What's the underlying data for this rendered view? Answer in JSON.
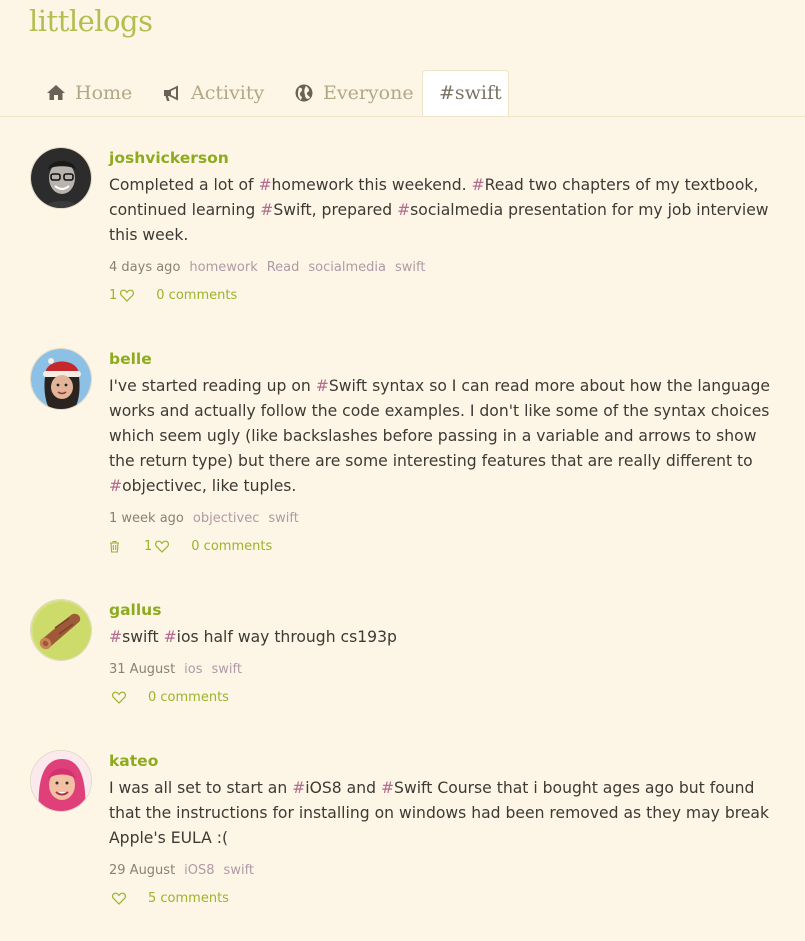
{
  "site": {
    "logo": "littlelogs"
  },
  "tabs": [
    {
      "label": "Home",
      "icon": "home-icon"
    },
    {
      "label": "Activity",
      "icon": "megaphone-icon"
    },
    {
      "label": "Everyone",
      "icon": "globe-icon"
    },
    {
      "label": "#swift",
      "active": true
    }
  ],
  "posts": [
    {
      "username": "joshvickerson",
      "avatar": "avatar-photo-glasses",
      "segments": [
        {
          "t": "Completed a lot of "
        },
        {
          "h": "#"
        },
        {
          "t": "homework this weekend. "
        },
        {
          "h": "#"
        },
        {
          "t": "Read two chapters of my textbook, continued learning "
        },
        {
          "h": "#"
        },
        {
          "t": "Swift, prepared "
        },
        {
          "h": "#"
        },
        {
          "t": "socialmedia presentation for my job interview this week."
        }
      ],
      "time": "4 days ago",
      "tags": [
        "homework",
        "Read",
        "socialmedia",
        "swift"
      ],
      "likes": "1",
      "comments": "0 comments",
      "trash": false
    },
    {
      "username": "belle",
      "avatar": "avatar-santa-hat",
      "segments": [
        {
          "t": "I've started reading up on "
        },
        {
          "h": "#"
        },
        {
          "t": "Swift syntax so I can read more about how the language works and actually follow the code examples. I don't like some of the syntax choices which seem ugly (like backslashes before passing in a variable and arrows to show the return type) but there are some interesting features that are really different to "
        },
        {
          "h": "#"
        },
        {
          "t": "objectivec, like tuples."
        }
      ],
      "time": "1 week ago",
      "tags": [
        "objectivec",
        "swift"
      ],
      "likes": "1",
      "comments": "0 comments",
      "trash": true
    },
    {
      "username": "gallus",
      "avatar": "avatar-log",
      "segments": [
        {
          "h": "#"
        },
        {
          "t": "swift "
        },
        {
          "h": "#"
        },
        {
          "t": "ios half way through cs193p"
        }
      ],
      "time": "31 August",
      "tags": [
        "ios",
        "swift"
      ],
      "likes": "",
      "comments": "0 comments",
      "trash": false
    },
    {
      "username": "kateo",
      "avatar": "avatar-pink-hair",
      "segments": [
        {
          "t": "I was all set to start an "
        },
        {
          "h": "#"
        },
        {
          "t": "iOS8 and "
        },
        {
          "h": "#"
        },
        {
          "t": "Swift Course that i bought ages ago but found that the instructions for installing on windows had been removed as they may break Apple's EULA :("
        }
      ],
      "time": "29 August",
      "tags": [
        "iOS8",
        "swift"
      ],
      "likes": "",
      "comments": "5 comments",
      "trash": false
    }
  ],
  "colors": {
    "background": "#fdf6e6",
    "logo": "#b4bd4f",
    "username": "#8eab1f",
    "hashtag": "#b36a8e",
    "action": "#9cb32c"
  }
}
